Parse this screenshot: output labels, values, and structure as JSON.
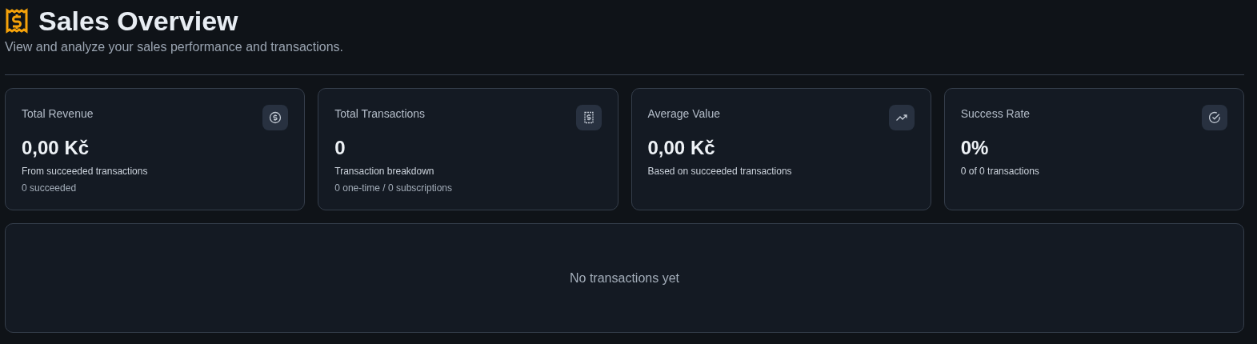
{
  "header": {
    "title": "Sales Overview",
    "subtitle": "View and analyze your sales performance and transactions."
  },
  "stats": [
    {
      "label": "Total Revenue",
      "kind": "revenue",
      "value": "0,00 Kč",
      "caption": "From succeeded transactions",
      "detail": "0 succeeded"
    },
    {
      "label": "Total Transactions",
      "kind": "count",
      "value": "0",
      "caption": "Transaction breakdown",
      "detail": "0 one-time / 0 subscriptions"
    },
    {
      "label": "Average Value",
      "kind": "average",
      "value": "0,00 Kč",
      "caption": "Based on succeeded transactions"
    },
    {
      "label": "Success Rate",
      "kind": "rate",
      "value": "0%",
      "caption": "0 of 0 transactions"
    }
  ],
  "transactions": {
    "empty_message": "No transactions yet"
  }
}
